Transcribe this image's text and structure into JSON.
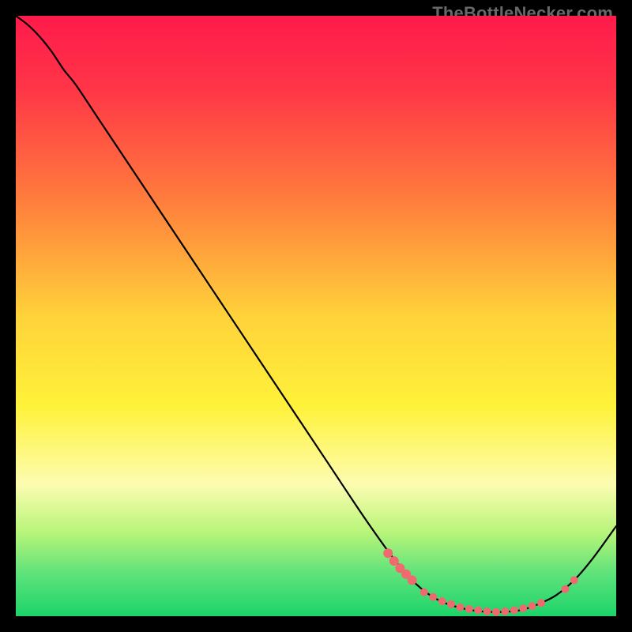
{
  "watermark": "TheBottleNecker.com",
  "chart_data": {
    "type": "line",
    "title": "",
    "xlabel": "",
    "ylabel": "",
    "xlim": [
      0,
      100
    ],
    "ylim": [
      0,
      100
    ],
    "grid": false,
    "gradient_stops": [
      {
        "offset": 0.0,
        "color": "#ff1a4b"
      },
      {
        "offset": 0.12,
        "color": "#ff3547"
      },
      {
        "offset": 0.3,
        "color": "#ff7a3d"
      },
      {
        "offset": 0.5,
        "color": "#ffd23a"
      },
      {
        "offset": 0.65,
        "color": "#fff23a"
      },
      {
        "offset": 0.78,
        "color": "#fdfcb0"
      },
      {
        "offset": 0.86,
        "color": "#b8f57a"
      },
      {
        "offset": 0.93,
        "color": "#5de27a"
      },
      {
        "offset": 1.0,
        "color": "#1cd46a"
      }
    ],
    "series": [
      {
        "name": "curve",
        "points": [
          {
            "x": 0.0,
            "y": 100.0
          },
          {
            "x": 2.0,
            "y": 98.5
          },
          {
            "x": 4.0,
            "y": 96.5
          },
          {
            "x": 6.0,
            "y": 94.0
          },
          {
            "x": 8.0,
            "y": 91.0
          },
          {
            "x": 10.0,
            "y": 88.5
          },
          {
            "x": 14.0,
            "y": 82.5
          },
          {
            "x": 20.0,
            "y": 73.5
          },
          {
            "x": 28.0,
            "y": 61.5
          },
          {
            "x": 36.0,
            "y": 49.5
          },
          {
            "x": 44.0,
            "y": 37.5
          },
          {
            "x": 52.0,
            "y": 25.5
          },
          {
            "x": 58.0,
            "y": 16.5
          },
          {
            "x": 63.0,
            "y": 9.5
          },
          {
            "x": 66.0,
            "y": 6.0
          },
          {
            "x": 69.0,
            "y": 3.5
          },
          {
            "x": 72.0,
            "y": 2.0
          },
          {
            "x": 76.0,
            "y": 1.0
          },
          {
            "x": 80.0,
            "y": 0.7
          },
          {
            "x": 84.0,
            "y": 1.0
          },
          {
            "x": 87.0,
            "y": 2.0
          },
          {
            "x": 90.0,
            "y": 3.5
          },
          {
            "x": 93.0,
            "y": 6.0
          },
          {
            "x": 96.0,
            "y": 9.5
          },
          {
            "x": 100.0,
            "y": 15.0
          }
        ]
      }
    ],
    "marker_clusters": [
      {
        "name": "left-edge",
        "color": "#ef6a6f",
        "radius": 6,
        "points": [
          {
            "x": 62.0,
            "y": 10.5
          },
          {
            "x": 63.0,
            "y": 9.2
          },
          {
            "x": 64.0,
            "y": 8.0
          },
          {
            "x": 65.0,
            "y": 7.0
          },
          {
            "x": 66.0,
            "y": 6.0
          }
        ]
      },
      {
        "name": "bottom-cluster",
        "color": "#ef6a6f",
        "radius": 5,
        "points": [
          {
            "x": 68.0,
            "y": 4.0
          },
          {
            "x": 69.5,
            "y": 3.2
          },
          {
            "x": 71.0,
            "y": 2.5
          },
          {
            "x": 72.5,
            "y": 2.0
          },
          {
            "x": 74.0,
            "y": 1.5
          },
          {
            "x": 75.5,
            "y": 1.2
          },
          {
            "x": 77.0,
            "y": 1.0
          },
          {
            "x": 78.5,
            "y": 0.8
          },
          {
            "x": 80.0,
            "y": 0.7
          },
          {
            "x": 81.5,
            "y": 0.8
          },
          {
            "x": 83.0,
            "y": 1.0
          },
          {
            "x": 84.5,
            "y": 1.3
          },
          {
            "x": 86.0,
            "y": 1.7
          },
          {
            "x": 87.5,
            "y": 2.2
          }
        ]
      },
      {
        "name": "right-pair",
        "color": "#ef6a6f",
        "radius": 5,
        "points": [
          {
            "x": 91.5,
            "y": 4.5
          },
          {
            "x": 93.0,
            "y": 6.0
          }
        ]
      }
    ]
  }
}
